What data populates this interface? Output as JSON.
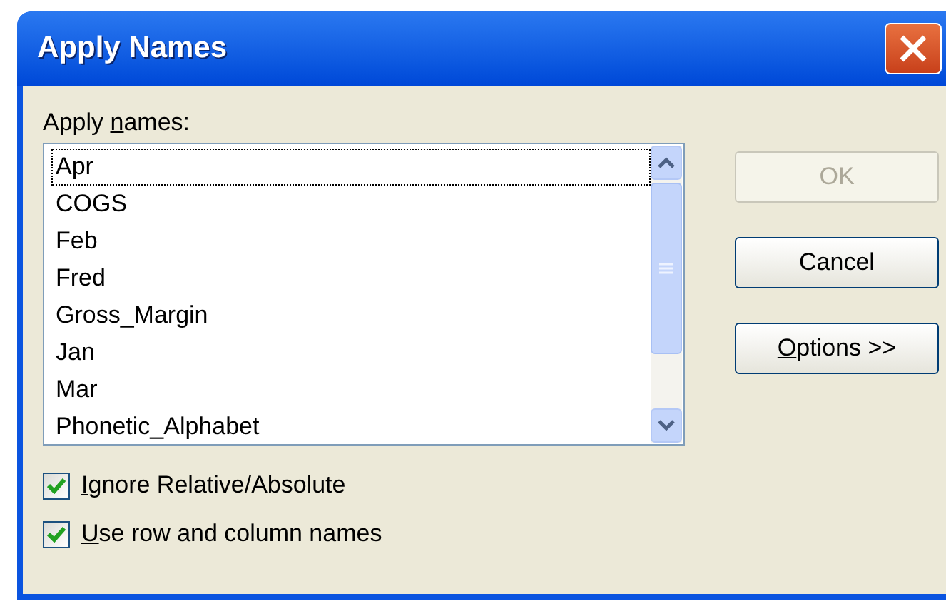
{
  "window": {
    "title": "Apply Names"
  },
  "names_label": {
    "before": "Apply ",
    "access_key": "n",
    "after": "ames:"
  },
  "names": [
    {
      "text": "Apr",
      "focused": true
    },
    {
      "text": "COGS",
      "focused": false
    },
    {
      "text": "Feb",
      "focused": false
    },
    {
      "text": "Fred",
      "focused": false
    },
    {
      "text": "Gross_Margin",
      "focused": false
    },
    {
      "text": "Jan",
      "focused": false
    },
    {
      "text": "Mar",
      "focused": false
    },
    {
      "text": "Phonetic_Alphabet",
      "focused": false
    }
  ],
  "buttons": [
    {
      "after": "OK",
      "disabled": true
    },
    {
      "after": "Cancel",
      "disabled": false,
      "default": true
    },
    {
      "access_key": "O",
      "after": "ptions >>",
      "disabled": false,
      "default": true
    }
  ],
  "options": [
    {
      "access_key": "I",
      "after": "gnore Relative/Absolute",
      "checked": true
    },
    {
      "access_key": "U",
      "after": "se row and column names",
      "checked": true
    }
  ]
}
